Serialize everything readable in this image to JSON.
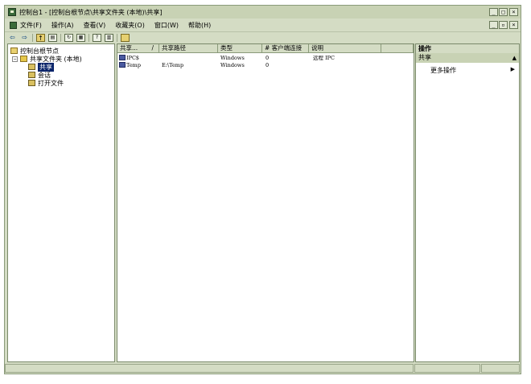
{
  "window": {
    "title": "控制台1 - [控制台根节点\\共享文件夹 (本地)\\共享]",
    "controls": {
      "minimize": "_",
      "maximize": "□",
      "close": "×"
    }
  },
  "menubar": {
    "items": [
      {
        "label": "文件(F)"
      },
      {
        "label": "操作(A)"
      },
      {
        "label": "查看(V)"
      },
      {
        "label": "收藏夹(O)"
      },
      {
        "label": "窗口(W)"
      },
      {
        "label": "帮助(H)"
      }
    ],
    "child_controls": {
      "minimize": "_",
      "restore": "▫",
      "close": "×"
    }
  },
  "toolbar": {
    "back_icon": "arrow-left-icon",
    "forward_icon": "arrow-right-icon",
    "up_glyph": "↑"
  },
  "tree": {
    "root": "控制台根节点",
    "shared_folders": "共享文件夹 (本地)",
    "shared_folders_expander": "−",
    "children": [
      {
        "label": "共享",
        "selected": true
      },
      {
        "label": "会话",
        "selected": false
      },
      {
        "label": "打开文件",
        "selected": false
      }
    ]
  },
  "list": {
    "columns": [
      {
        "label": "共享...",
        "sort": "/"
      },
      {
        "label": "共享路径"
      },
      {
        "label": "类型"
      },
      {
        "label": "# 客户端连接"
      },
      {
        "label": "说明"
      }
    ],
    "rows": [
      {
        "name": "IPC$",
        "path": "",
        "type": "Windows",
        "clients": "0",
        "description": "远程 IPC"
      },
      {
        "name": "Temp",
        "path": "E:\\Temp",
        "type": "Windows",
        "clients": "0",
        "description": ""
      }
    ]
  },
  "actions": {
    "header": "操作",
    "group": "共享",
    "group_caret": "▲",
    "more": "更多操作",
    "more_arrow": "▶"
  },
  "colors": {
    "chrome": "#d4dcc4",
    "selection": "#0a246a"
  }
}
